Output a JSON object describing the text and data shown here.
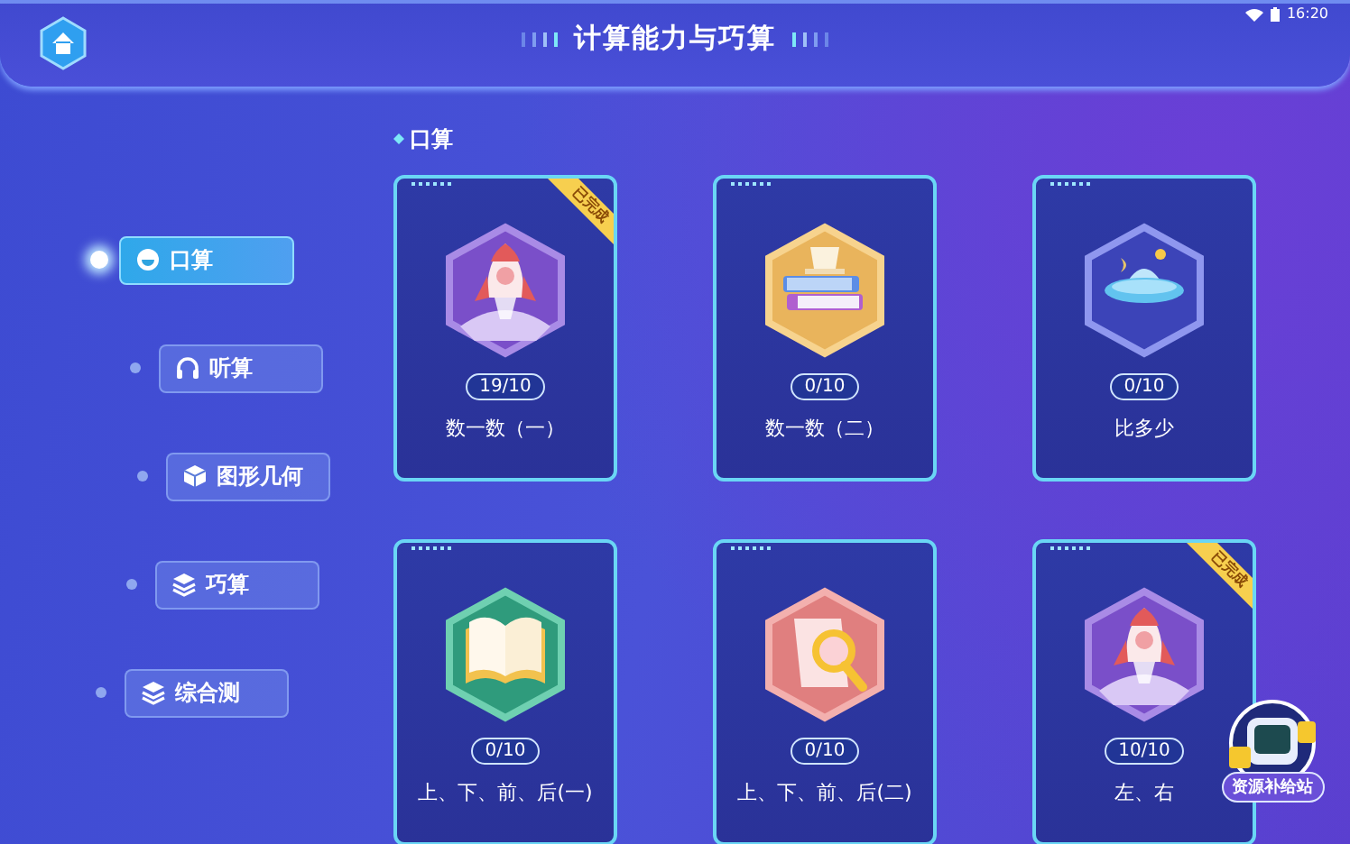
{
  "header": {
    "title": "计算能力与巧算",
    "time": "16:20"
  },
  "sidebar": {
    "items": [
      {
        "label": "口算",
        "selected": true
      },
      {
        "label": "听算",
        "selected": false
      },
      {
        "label": "图形几何",
        "selected": false
      },
      {
        "label": "巧算",
        "selected": false
      },
      {
        "label": "综合测",
        "selected": false
      }
    ]
  },
  "section": {
    "title": "口算"
  },
  "cards": [
    {
      "progress": "19/10",
      "name": "数一数（一）",
      "badge": "已完成"
    },
    {
      "progress": "0/10",
      "name": "数一数（二）"
    },
    {
      "progress": "0/10",
      "name": "比多少"
    },
    {
      "progress": "0/10",
      "name": "上、下、前、后(一)"
    },
    {
      "progress": "0/10",
      "name": "上、下、前、后(二)"
    },
    {
      "progress": "10/10",
      "name": "左、右",
      "badge": "已完成"
    }
  ],
  "supply_button": {
    "label": "资源补给站"
  }
}
